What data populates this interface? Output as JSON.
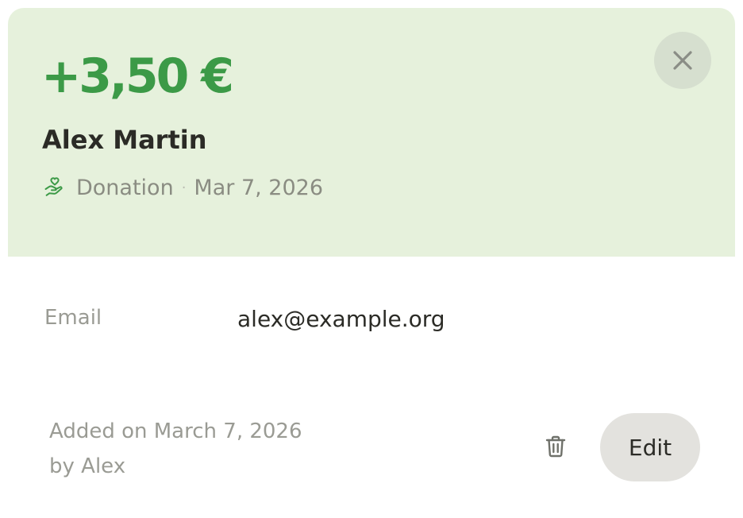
{
  "transaction": {
    "amount": "+3,50 €",
    "name": "Alex Martin",
    "category": "Donation",
    "category_icon": "hand-heart-icon",
    "separator": "·",
    "date": "Mar 7, 2026"
  },
  "details": {
    "email_label": "Email",
    "email_value": "alex@example.org"
  },
  "footer": {
    "added_on": "Added on March 7, 2026",
    "added_by": "by Alex"
  },
  "actions": {
    "close_icon": "close-icon",
    "delete_icon": "trash-icon",
    "edit_label": "Edit"
  },
  "colors": {
    "header_bg": "#e6f1dc",
    "amount_green": "#3c9a47",
    "close_bg": "#d6dfcf",
    "edit_bg": "#e3e2de"
  }
}
